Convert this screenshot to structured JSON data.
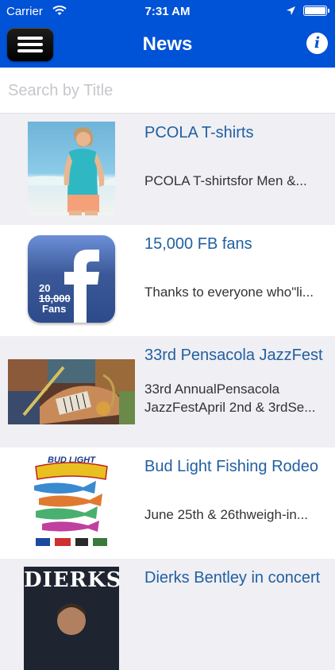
{
  "status_bar": {
    "carrier": "Carrier",
    "time": "7:31 AM"
  },
  "nav": {
    "title": "News",
    "info_label": "i",
    "brand_color": "#0052D6"
  },
  "search": {
    "placeholder": "Search by Title",
    "value": ""
  },
  "news": [
    {
      "title": "PCOLA T-shirts",
      "description": "PCOLA T-shirtsfor Men &..."
    },
    {
      "title": "15,000 FB fans",
      "description": "Thanks to everyone who\"li...",
      "thumb_text": {
        "top": "20",
        "mid": "10,000",
        "bottom": "Fans"
      }
    },
    {
      "title": "33rd Pensacola JazzFest",
      "description_lines": [
        "33rd AnnualPensacola",
        "JazzFestApril 2nd & 3rdSe..."
      ]
    },
    {
      "title": "Bud Light Fishing Rodeo",
      "description": "June 25th & 26thweigh-in...",
      "thumb_text": {
        "brand": "BUD LIGHT"
      }
    },
    {
      "title": "Dierks Bentley in concert",
      "thumb_text": {
        "name": "DIERKS"
      }
    }
  ]
}
